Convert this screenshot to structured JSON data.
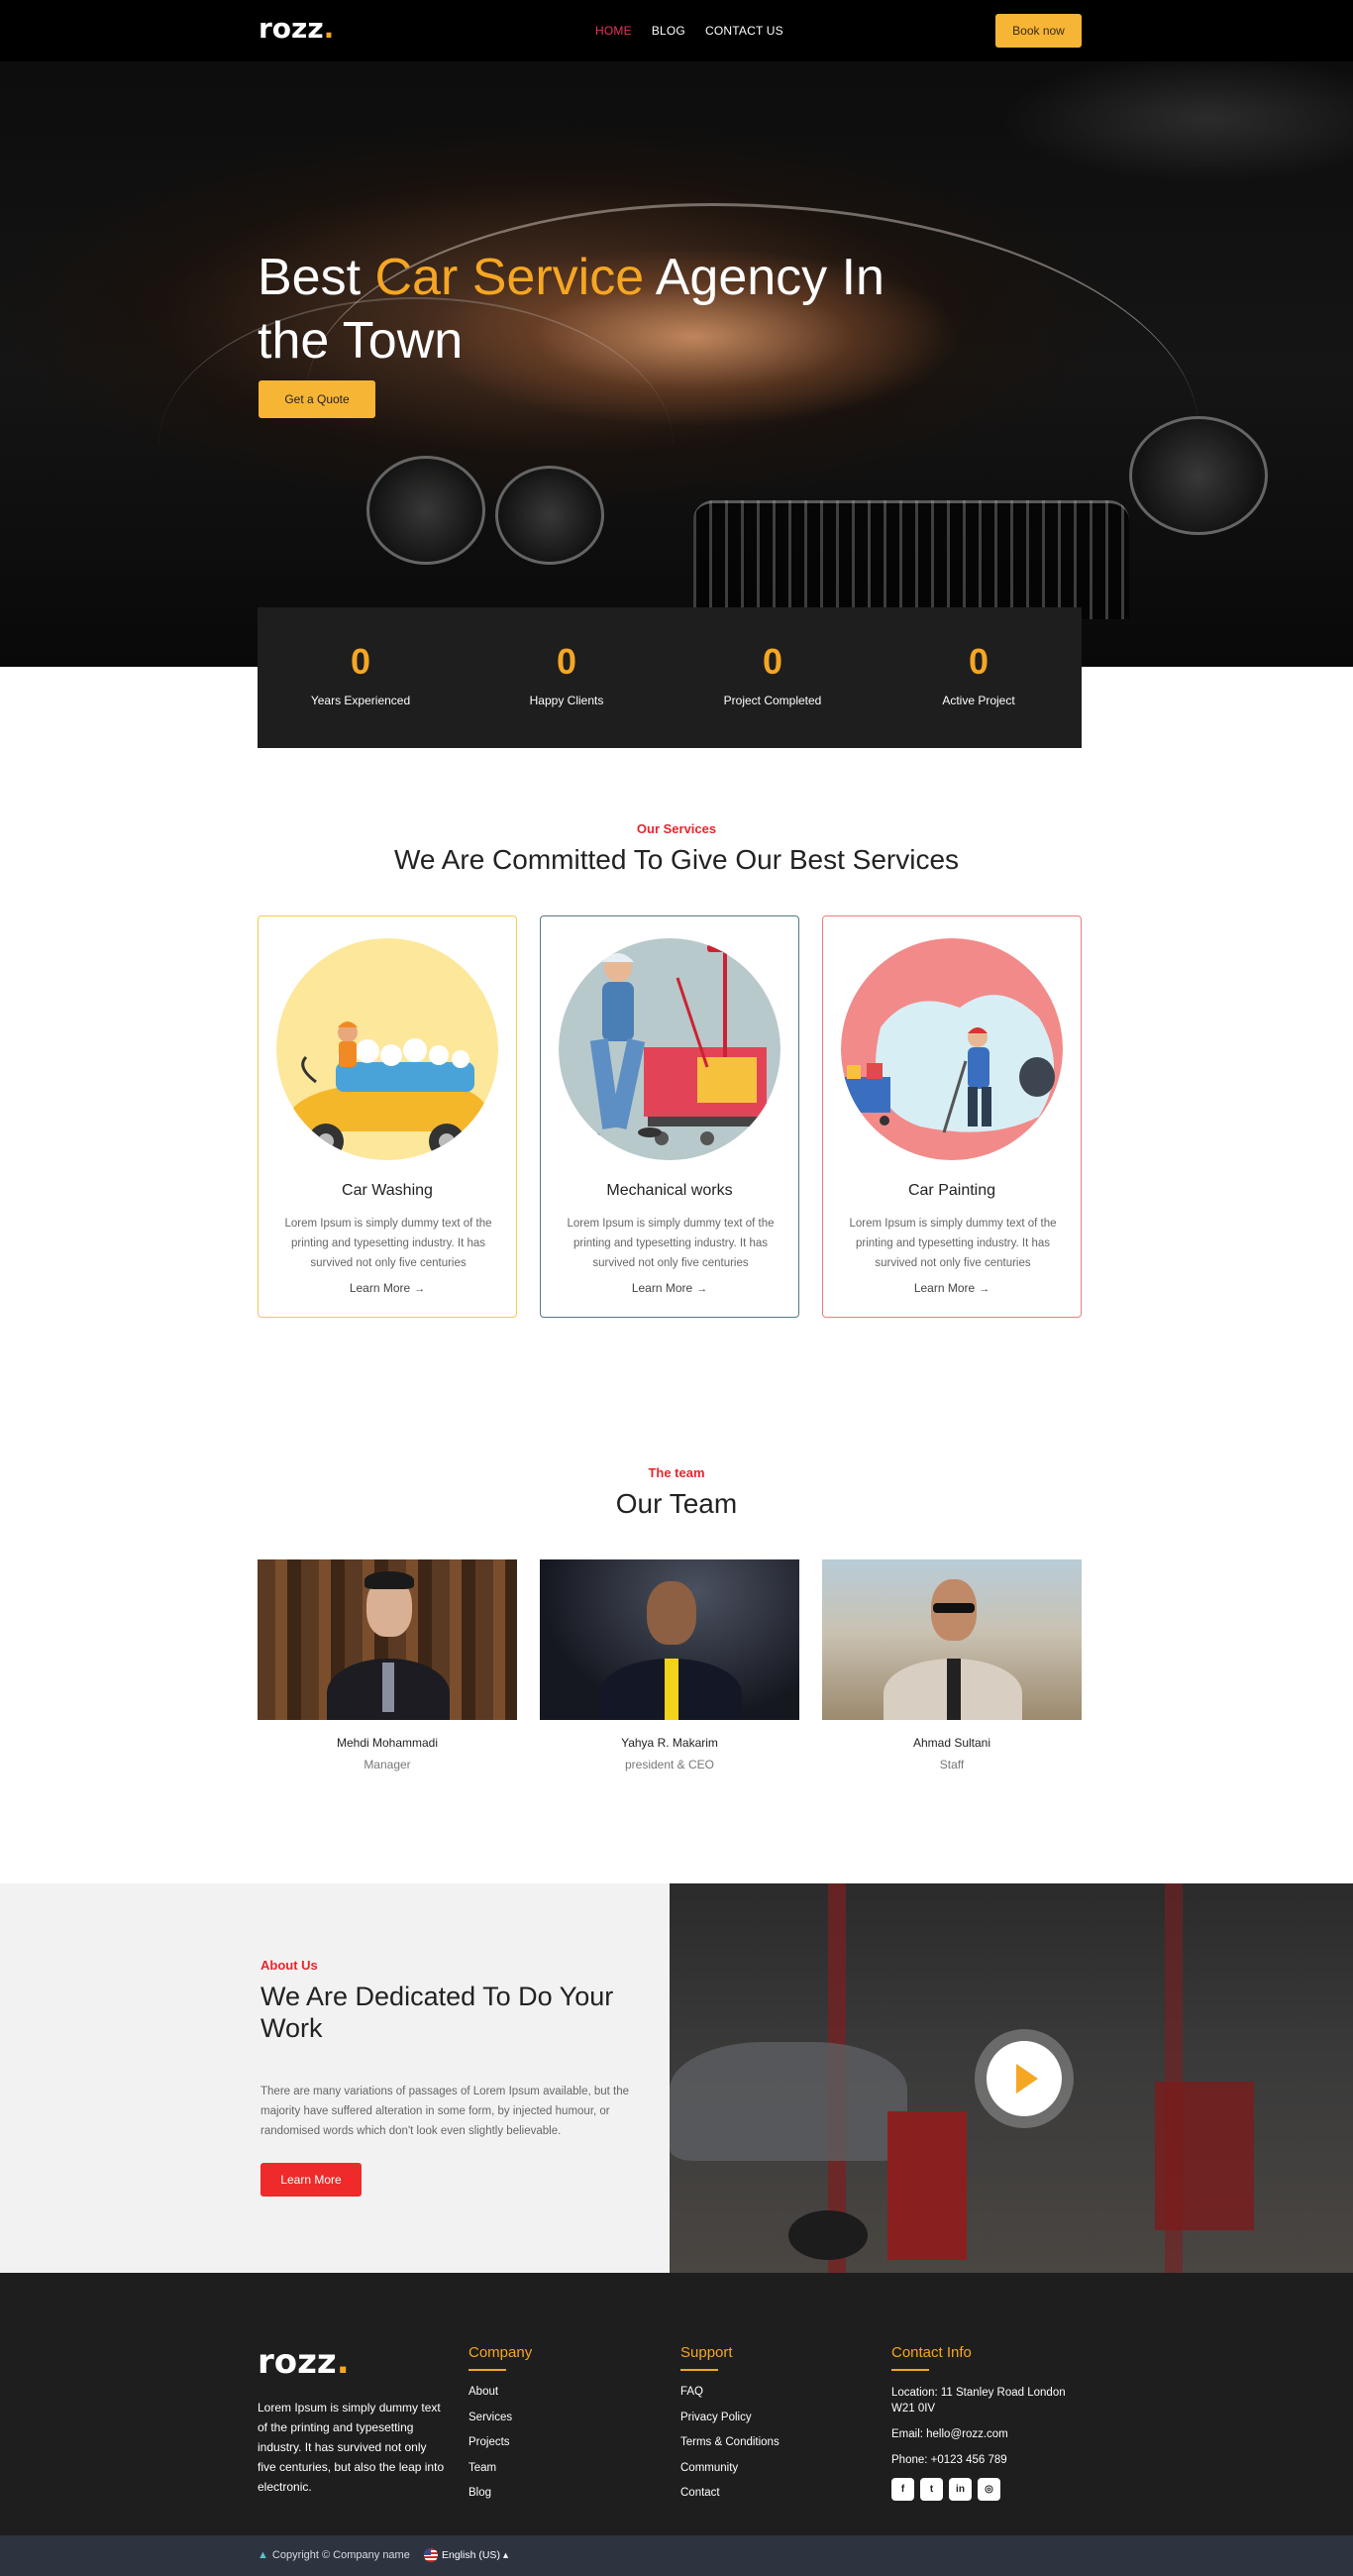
{
  "nav": {
    "logo_text": "rozz",
    "logo_dot": ".",
    "links": [
      "HOME",
      "BLOG",
      "CONTACT US"
    ],
    "book_label": "Book now"
  },
  "hero": {
    "title_part1": "Best ",
    "title_highlight": "Car Service",
    "title_part2": " Agency In the Town",
    "cta_label": "Get a Quote"
  },
  "stats": [
    {
      "value": "0",
      "label": "Years Experienced"
    },
    {
      "value": "0",
      "label": "Happy Clients"
    },
    {
      "value": "0",
      "label": "Project Completed"
    },
    {
      "value": "0",
      "label": "Active Project"
    }
  ],
  "services": {
    "eyebrow": "Our Services",
    "title": "We Are Committed To Give Our Best Services",
    "cards": [
      {
        "name": "Car Washing",
        "desc": "Lorem Ipsum is simply dummy text of the printing and typesetting industry. It has survived not only five centuries",
        "link": "Learn More",
        "border": "#f7c948",
        "circle": "#fde79a"
      },
      {
        "name": "Mechanical works",
        "desc": "Lorem Ipsum is simply dummy text of the printing and typesetting industry. It has survived not only five centuries",
        "link": "Learn More",
        "border": "#557a80",
        "circle": "#b8c9cb"
      },
      {
        "name": "Car Painting",
        "desc": "Lorem Ipsum is simply dummy text of the printing and typesetting industry. It has survived not only five centuries",
        "link": "Learn More",
        "border": "#ee7b7b",
        "circle": "#f28a8a"
      }
    ]
  },
  "team": {
    "eyebrow": "The team",
    "title": "Our Team",
    "members": [
      {
        "name": "Mehdi Mohammadi",
        "role": "Manager"
      },
      {
        "name": "Yahya R. Makarim",
        "role": "president & CEO"
      },
      {
        "name": "Ahmad Sultani",
        "role": "Staff"
      }
    ]
  },
  "about": {
    "eyebrow": "About Us",
    "title": "We Are Dedicated To Do Your Work",
    "text": "There are many variations of passages of Lorem Ipsum available, but the majority have suffered alteration in some form, by injected humour, or randomised words which don't look even slightly believable.",
    "button": "Learn More"
  },
  "footer": {
    "logo_text": "rozz",
    "logo_dot": ".",
    "about": "Lorem Ipsum is simply dummy text of the printing and typesetting industry. It has survived not only five centuries, but also the leap into electronic.",
    "company_title": "Company",
    "company_links": [
      "About",
      "Services",
      "Projects",
      "Team",
      "Blog"
    ],
    "support_title": "Support",
    "support_links": [
      "FAQ",
      "Privacy Policy",
      "Terms & Conditions",
      "Community",
      "Contact"
    ],
    "contact_title": "Contact Info",
    "location": "Location: 11 Stanley Road London W21 0IV",
    "email": "Email:  hello@rozz.com",
    "phone": "Phone:  +0123 456 789",
    "socials": [
      "facebook-icon",
      "twitter-icon",
      "linkedin-icon",
      "instagram-icon"
    ],
    "copyright": "Copyright © Company name",
    "language": "English (US)"
  },
  "colors": {
    "accent": "#f5a623",
    "red": "#e8252e",
    "nav_active": "#e8345b",
    "dark": "#1e1e1e"
  }
}
